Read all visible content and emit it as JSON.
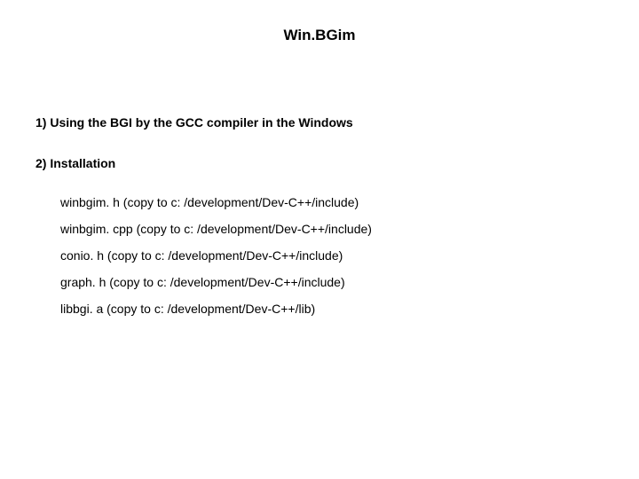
{
  "title": "Win.BGim",
  "section1": {
    "heading": "1) Using the BGI by the GCC compiler in the Windows"
  },
  "section2": {
    "heading": "2) Installation",
    "items": [
      "winbgim. h (copy to c: /development/Dev-C++/include)",
      "winbgim. cpp (copy to c: /development/Dev-C++/include)",
      "conio. h (copy to c: /development/Dev-C++/include)",
      "graph. h (copy to c: /development/Dev-C++/include)",
      "libbgi. a  (copy to c: /development/Dev-C++/lib)"
    ]
  }
}
